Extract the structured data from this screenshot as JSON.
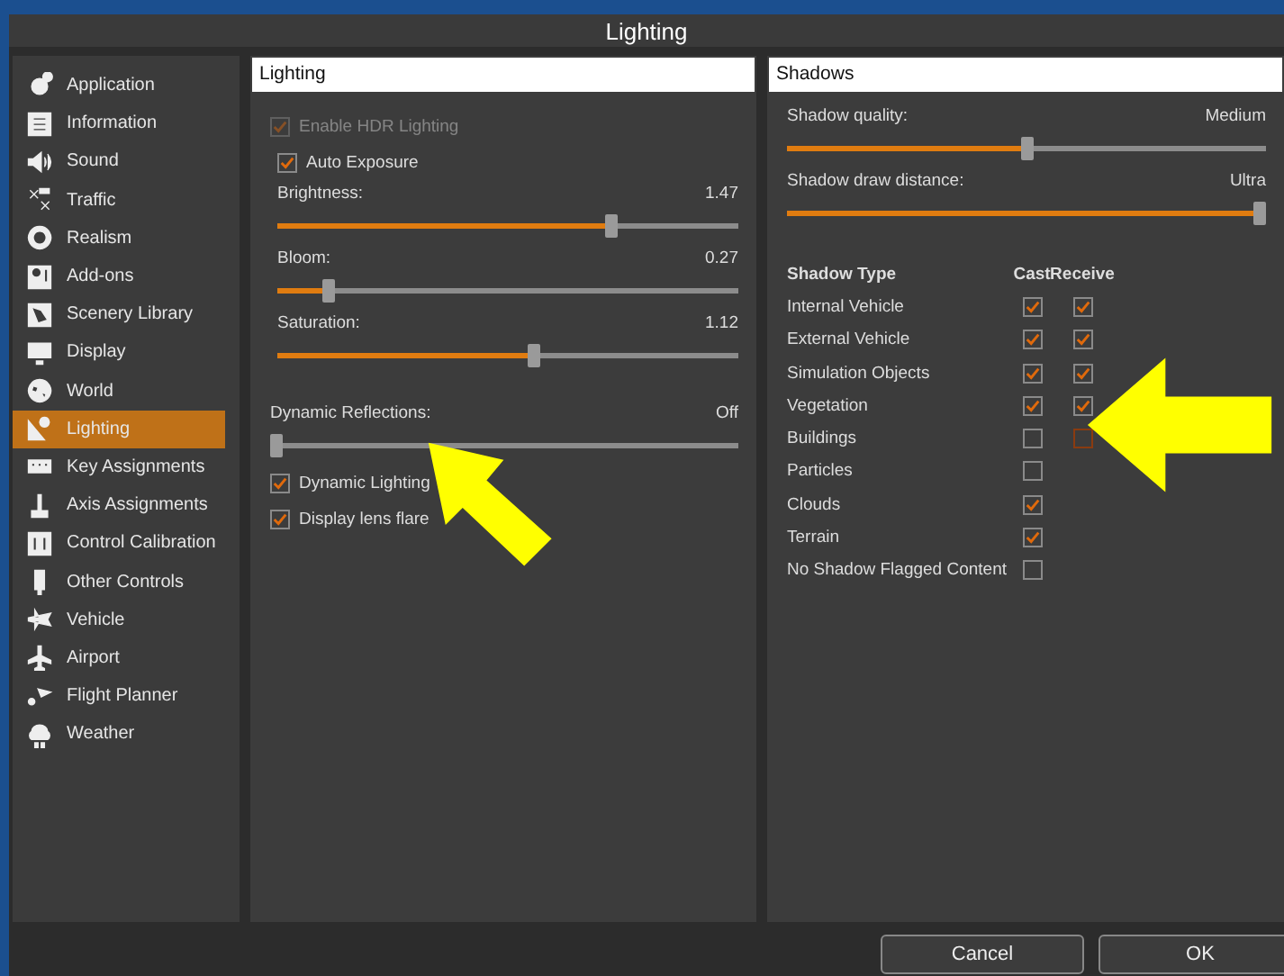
{
  "window": {
    "title": "Lighting"
  },
  "sidebar": {
    "items": [
      {
        "label": "Application",
        "selected": false
      },
      {
        "label": "Information",
        "selected": false
      },
      {
        "label": "Sound",
        "selected": false
      },
      {
        "label": "Traffic",
        "selected": false
      },
      {
        "label": "Realism",
        "selected": false
      },
      {
        "label": "Add-ons",
        "selected": false
      },
      {
        "label": "Scenery Library",
        "selected": false
      },
      {
        "label": "Display",
        "selected": false
      },
      {
        "label": "World",
        "selected": false
      },
      {
        "label": "Lighting",
        "selected": true
      },
      {
        "label": "Key Assignments",
        "selected": false
      },
      {
        "label": "Axis Assignments",
        "selected": false
      },
      {
        "label": "Control Calibration",
        "selected": false
      },
      {
        "label": "Other Controls",
        "selected": false
      },
      {
        "label": "Vehicle",
        "selected": false
      },
      {
        "label": "Airport",
        "selected": false
      },
      {
        "label": "Flight Planner",
        "selected": false
      },
      {
        "label": "Weather",
        "selected": false
      }
    ]
  },
  "lighting": {
    "title": "Lighting",
    "items": [
      {
        "kind": "checkbox",
        "label": "Enable HDR Lighting",
        "checked": true,
        "disabled": true,
        "children": [
          {
            "kind": "checkbox",
            "label": "Auto Exposure",
            "checked": true,
            "disabled": false
          },
          {
            "kind": "slider",
            "label": "Brightness:",
            "reading": "1.47",
            "level": 0.73
          },
          {
            "kind": "slider",
            "label": "Bloom:",
            "reading": "0.27",
            "level": 0.1
          },
          {
            "kind": "slider",
            "label": "Saturation:",
            "reading": "1.12",
            "level": 0.56
          }
        ]
      },
      {
        "kind": "slider",
        "label": "Dynamic Reflections:",
        "reading": "Off",
        "level": 0.0
      },
      {
        "kind": "checkbox",
        "label": "Dynamic Lighting",
        "checked": true,
        "disabled": false
      },
      {
        "kind": "checkbox",
        "label": "Display lens flare",
        "checked": true,
        "disabled": false
      }
    ]
  },
  "shadows": {
    "title": "Shadows",
    "sliders": [
      {
        "label": "Shadow quality:",
        "reading": "Medium",
        "level": 0.5
      },
      {
        "label": "Shadow draw distance:",
        "reading": "Ultra",
        "level": 1.0
      }
    ],
    "columns": [
      "Shadow Type",
      "Cast",
      "Receive"
    ],
    "rows": [
      {
        "type": "Internal Vehicle",
        "cast": true,
        "receive": true
      },
      {
        "type": "External Vehicle",
        "cast": true,
        "receive": true
      },
      {
        "type": "Simulation Objects",
        "cast": true,
        "receive": true
      },
      {
        "type": "Vegetation",
        "cast": true,
        "receive": true
      },
      {
        "type": "Buildings",
        "cast": false,
        "receive": false
      },
      {
        "type": "Particles",
        "cast": false
      },
      {
        "type": "Clouds",
        "cast": true
      },
      {
        "type": "Terrain",
        "cast": true
      },
      {
        "type": "No Shadow Flagged Content",
        "cast": false
      }
    ]
  },
  "buttons": [
    {
      "label": "Cancel"
    },
    {
      "label": "OK"
    }
  ]
}
